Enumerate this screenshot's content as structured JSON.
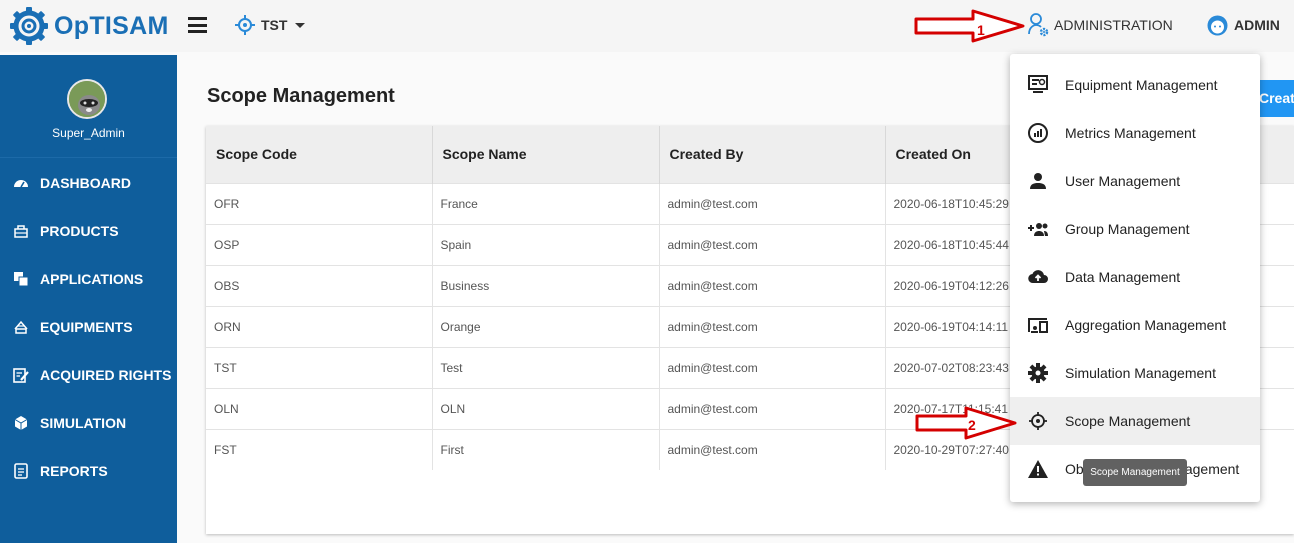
{
  "app": {
    "name": "OpTISAM"
  },
  "header": {
    "scope_selected": "TST",
    "admin_menu_label": "ADMINISTRATION",
    "user_label": "ADMIN"
  },
  "sidebar": {
    "username": "Super_Admin",
    "items": [
      {
        "label": "DASHBOARD",
        "icon": "dashboard-icon"
      },
      {
        "label": "PRODUCTS",
        "icon": "products-icon"
      },
      {
        "label": "APPLICATIONS",
        "icon": "applications-icon"
      },
      {
        "label": "EQUIPMENTS",
        "icon": "equipments-icon"
      },
      {
        "label": "ACQUIRED RIGHTS",
        "icon": "acquired-rights-icon"
      },
      {
        "label": "SIMULATION",
        "icon": "simulation-icon"
      },
      {
        "label": "REPORTS",
        "icon": "reports-icon"
      }
    ]
  },
  "main": {
    "title": "Scope Management",
    "create_label": "Create",
    "table": {
      "columns": [
        "Scope Code",
        "Scope Name",
        "Created By",
        "Created On"
      ],
      "rows": [
        [
          "OFR",
          "France",
          "admin@test.com",
          "2020-06-18T10:45:29"
        ],
        [
          "OSP",
          "Spain",
          "admin@test.com",
          "2020-06-18T10:45:44"
        ],
        [
          "OBS",
          "Business",
          "admin@test.com",
          "2020-06-19T04:12:26"
        ],
        [
          "ORN",
          "Orange",
          "admin@test.com",
          "2020-06-19T04:14:11"
        ],
        [
          "TST",
          "Test",
          "admin@test.com",
          "2020-07-02T08:23:43"
        ],
        [
          "OLN",
          "OLN",
          "admin@test.com",
          "2020-07-17T11:15:41"
        ],
        [
          "FST",
          "First",
          "admin@test.com",
          "2020-10-29T07:27:40"
        ]
      ]
    }
  },
  "admin_dropdown": {
    "items": [
      {
        "label": "Equipment Management",
        "icon": "equipment-management-icon"
      },
      {
        "label": "Metrics Management",
        "icon": "metrics-icon"
      },
      {
        "label": "User Management",
        "icon": "person-icon"
      },
      {
        "label": "Group Management",
        "icon": "group-add-icon"
      },
      {
        "label": "Data Management",
        "icon": "cloud-upload-icon"
      },
      {
        "label": "Aggregation Management",
        "icon": "devices-icon"
      },
      {
        "label": "Simulation Management",
        "icon": "settings-icon"
      },
      {
        "label": "Scope Management",
        "icon": "scope-target-icon"
      },
      {
        "label": "Obsolescence Management",
        "icon": "warning-icon"
      }
    ],
    "tooltip": "Scope Management"
  },
  "annotations": {
    "step1": "1",
    "step2": "2",
    "arrow_color": "#d40000"
  },
  "colors": {
    "sidebar_bg": "#0f5e9c",
    "brand": "#1a6fb5",
    "primary_button": "#2196f3"
  }
}
